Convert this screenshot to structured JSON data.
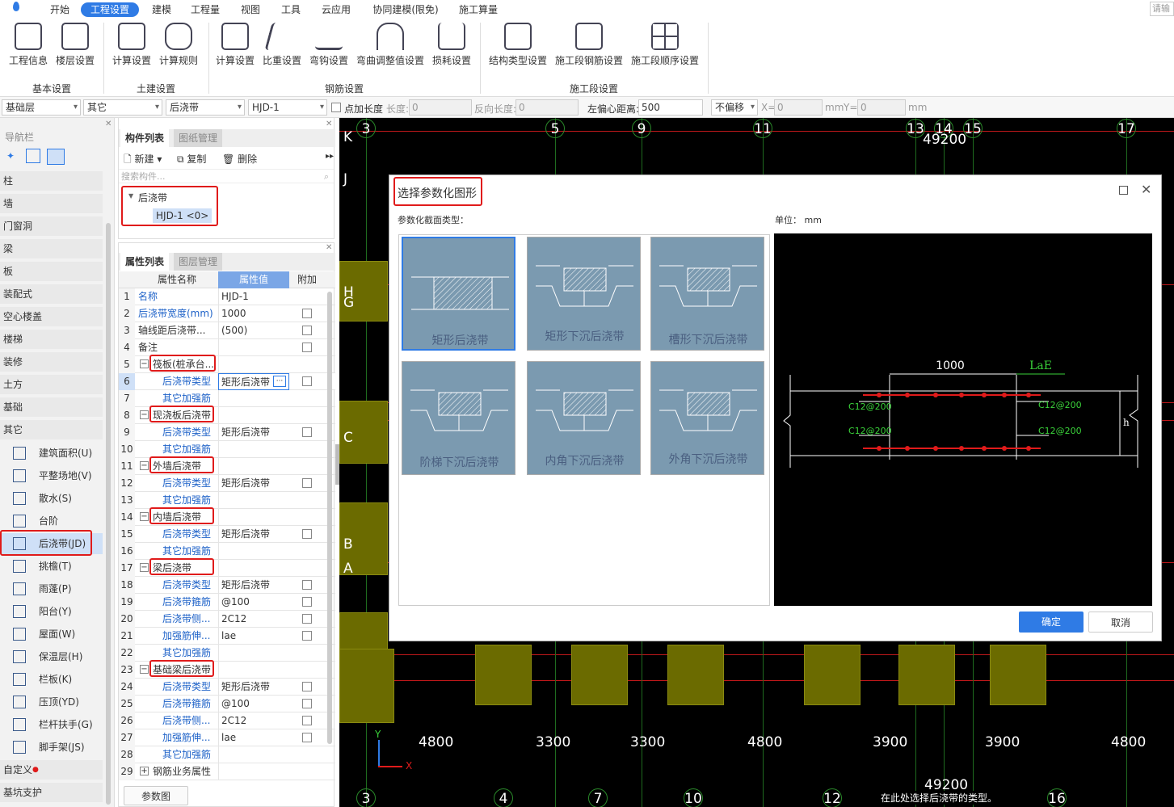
{
  "menu": {
    "items": [
      {
        "label": "开始"
      },
      {
        "label": "工程设置"
      },
      {
        "label": "建模"
      },
      {
        "label": "工程量"
      },
      {
        "label": "视图"
      },
      {
        "label": "工具"
      },
      {
        "label": "云应用"
      },
      {
        "label": "协同建模(限免)"
      },
      {
        "label": "施工算量"
      }
    ],
    "active_index": 1,
    "right_text": "请输"
  },
  "ribbon": {
    "buttons": [
      "工程信息",
      "楼层设置",
      "计算设置",
      "计算规则",
      "计算设置",
      "比重设置",
      "弯钩设置",
      "弯曲调整值设置",
      "损耗设置",
      "结构类型设置",
      "施工段钢筋设置",
      "施工段顺序设置"
    ],
    "groups": [
      "基本设置",
      "土建设置",
      "钢筋设置",
      "施工段设置"
    ]
  },
  "toolbar": {
    "floor": "基础层",
    "category": "其它",
    "type": "后浇带",
    "component": "HJD-1",
    "add_length_label": "点加长度",
    "length_label": "长度:",
    "length_value": "0",
    "reverse_label": "反向长度:",
    "reverse_value": "0",
    "offset_label": "左偏心距离:",
    "offset_value": "500",
    "offset_mode": "不偏移",
    "x_label": "X=",
    "x_value": "0",
    "x_unit": "mm",
    "y_label": "Y=",
    "y_value": "0",
    "y_unit": "mm"
  },
  "nav": {
    "title": "导航栏",
    "categories": [
      "柱",
      "墙",
      "门窗洞",
      "梁",
      "板",
      "装配式",
      "空心楼盖",
      "楼梯",
      "装修",
      "土方",
      "基础",
      "其它"
    ],
    "items": [
      "建筑面积(U)",
      "平整场地(V)",
      "散水(S)",
      "台阶",
      "后浇带(JD)",
      "挑檐(T)",
      "雨蓬(P)",
      "阳台(Y)",
      "屋面(W)",
      "保温层(H)",
      "栏板(K)",
      "压顶(YD)",
      "栏杆扶手(G)",
      "脚手架(JS)"
    ],
    "bottom": [
      "自定义",
      "基坑支护"
    ]
  },
  "component_panel": {
    "tabs": [
      "构件列表",
      "图纸管理"
    ],
    "new_label": "新建",
    "copy_label": "复制",
    "delete_label": "删除",
    "search_placeholder": "搜索构件...",
    "tree_parent": "后浇带",
    "tree_child": "HJD-1 <0>"
  },
  "property_panel": {
    "tabs": [
      "属性列表",
      "图层管理"
    ],
    "headers": [
      "属性名称",
      "属性值",
      "附加"
    ],
    "rows": [
      {
        "n": "1",
        "name": "名称",
        "value": "HJD-1",
        "blue": true,
        "indent": 0,
        "cb": false
      },
      {
        "n": "2",
        "name": "后浇带宽度(mm)",
        "value": "1000",
        "blue": true,
        "indent": 0,
        "cb": true
      },
      {
        "n": "3",
        "name": "轴线距后浇带...",
        "value": "(500)",
        "blue": false,
        "indent": 0,
        "cb": true
      },
      {
        "n": "4",
        "name": "备注",
        "value": "",
        "blue": false,
        "indent": 0,
        "cb": true
      },
      {
        "n": "5",
        "name": "筏板(桩承台...",
        "value": "",
        "blue": false,
        "indent": 1,
        "cb": false,
        "group": true
      },
      {
        "n": "6",
        "name": "后浇带类型",
        "value": "矩形后浇带",
        "blue": true,
        "indent": 2,
        "cb": true
      },
      {
        "n": "7",
        "name": "其它加强筋",
        "value": "",
        "blue": true,
        "indent": 2,
        "cb": false
      },
      {
        "n": "8",
        "name": "现浇板后浇带",
        "value": "",
        "blue": false,
        "indent": 1,
        "cb": false,
        "group": true
      },
      {
        "n": "9",
        "name": "后浇带类型",
        "value": "矩形后浇带",
        "blue": true,
        "indent": 2,
        "cb": true
      },
      {
        "n": "10",
        "name": "其它加强筋",
        "value": "",
        "blue": true,
        "indent": 2,
        "cb": false
      },
      {
        "n": "11",
        "name": "外墙后浇带",
        "value": "",
        "blue": false,
        "indent": 1,
        "cb": false,
        "group": true
      },
      {
        "n": "12",
        "name": "后浇带类型",
        "value": "矩形后浇带",
        "blue": true,
        "indent": 2,
        "cb": true
      },
      {
        "n": "13",
        "name": "其它加强筋",
        "value": "",
        "blue": true,
        "indent": 2,
        "cb": false
      },
      {
        "n": "14",
        "name": "内墙后浇带",
        "value": "",
        "blue": false,
        "indent": 1,
        "cb": false,
        "group": true
      },
      {
        "n": "15",
        "name": "后浇带类型",
        "value": "矩形后浇带",
        "blue": true,
        "indent": 2,
        "cb": true
      },
      {
        "n": "16",
        "name": "其它加强筋",
        "value": "",
        "blue": true,
        "indent": 2,
        "cb": false
      },
      {
        "n": "17",
        "name": "梁后浇带",
        "value": "",
        "blue": false,
        "indent": 1,
        "cb": false,
        "group": true
      },
      {
        "n": "18",
        "name": "后浇带类型",
        "value": "矩形后浇带",
        "blue": true,
        "indent": 2,
        "cb": true
      },
      {
        "n": "19",
        "name": "后浇带箍筋",
        "value": "@100",
        "blue": true,
        "indent": 2,
        "cb": true
      },
      {
        "n": "20",
        "name": "后浇带侧...",
        "value": "2C12",
        "blue": true,
        "indent": 2,
        "cb": true
      },
      {
        "n": "21",
        "name": "加强筋伸...",
        "value": "lae",
        "blue": true,
        "indent": 2,
        "cb": true
      },
      {
        "n": "22",
        "name": "其它加强筋",
        "value": "",
        "blue": true,
        "indent": 2,
        "cb": false
      },
      {
        "n": "23",
        "name": "基础梁后浇带",
        "value": "",
        "blue": false,
        "indent": 1,
        "cb": false,
        "group": true
      },
      {
        "n": "24",
        "name": "后浇带类型",
        "value": "矩形后浇带",
        "blue": true,
        "indent": 2,
        "cb": true
      },
      {
        "n": "25",
        "name": "后浇带箍筋",
        "value": "@100",
        "blue": true,
        "indent": 2,
        "cb": true
      },
      {
        "n": "26",
        "name": "后浇带侧...",
        "value": "2C12",
        "blue": true,
        "indent": 2,
        "cb": true
      },
      {
        "n": "27",
        "name": "加强筋伸...",
        "value": "lae",
        "blue": true,
        "indent": 2,
        "cb": true
      },
      {
        "n": "28",
        "name": "其它加强筋",
        "value": "",
        "blue": true,
        "indent": 2,
        "cb": false
      },
      {
        "n": "29",
        "name": "钢筋业务属性",
        "value": "",
        "blue": false,
        "indent": 1,
        "cb": false,
        "plus": true
      }
    ],
    "param_button": "参数图"
  },
  "canvas": {
    "top_axes": [
      "3",
      "5",
      "9",
      "11",
      "13",
      "14",
      "15",
      "17"
    ],
    "top_dim": "49200",
    "row_axes": [
      "K",
      "J",
      "H",
      "G",
      "C",
      "B",
      "A"
    ],
    "bottom_dims": [
      "4800",
      "3300",
      "3300",
      "4800",
      "3900",
      "3900",
      "4800"
    ],
    "bottom_axes": [
      "3",
      "4",
      "7",
      "10",
      "12",
      "16"
    ],
    "bottom_total": "49200",
    "ucs_x": "X",
    "ucs_y": "Y",
    "status_hint": "在此处选择后浇带的类型。"
  },
  "dialog": {
    "title": "选择参数化图形",
    "section_label": "参数化截面类型：",
    "unit_label": "单位：",
    "unit_value": "mm",
    "shapes": [
      "矩形后浇带",
      "矩形下沉后浇带",
      "槽形下沉后浇带",
      "阶梯下沉后浇带",
      "内角下沉后浇带",
      "外角下沉后浇带"
    ],
    "selected_index": 0,
    "preview": {
      "width_label": "1000",
      "lae_label": "LaE",
      "rebar_labels": [
        "C12@200",
        "C12@200",
        "C12@200",
        "C12@200"
      ],
      "h_label": "h"
    },
    "ok_label": "确定",
    "cancel_label": "取消"
  }
}
